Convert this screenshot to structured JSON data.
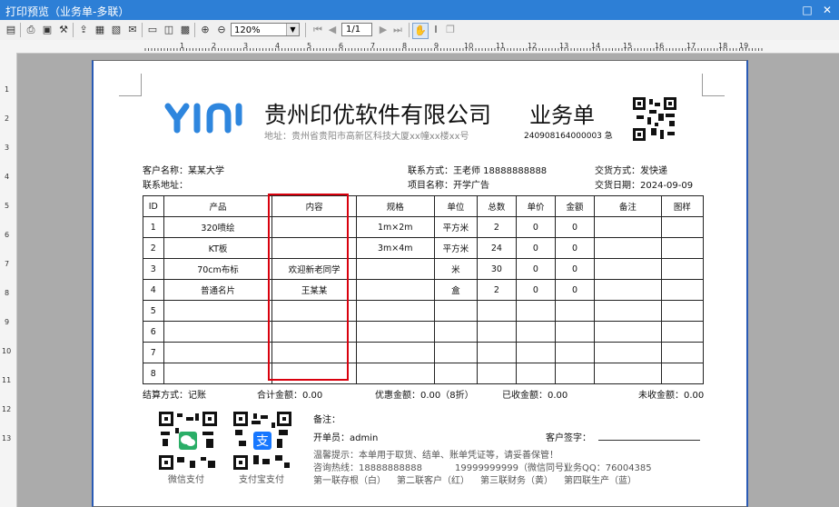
{
  "window": {
    "title": "打印预览（业务单-多联）"
  },
  "toolbar": {
    "zoom": "120%",
    "page": "1/1"
  },
  "ruler": {
    "h_marks": [
      "1",
      "2",
      "3",
      "4",
      "5",
      "6",
      "7",
      "8",
      "9",
      "10",
      "11",
      "12",
      "13",
      "14",
      "15",
      "16",
      "17",
      "18",
      "19"
    ],
    "v_marks": [
      "1",
      "2",
      "3",
      "4",
      "5",
      "6",
      "7",
      "8",
      "9",
      "10",
      "11",
      "12",
      "13"
    ]
  },
  "doc": {
    "company": "贵州印优软件有限公司",
    "address": "地址：贵州省贵阳市高新区科技大厦xx幢xx楼xx号",
    "doc_title": "业务单",
    "doc_no": "240908164000003 急",
    "customer": "客户名称：某某大学",
    "customer_addr": "联系地址：",
    "contact": "联系方式：王老师 18888888888",
    "project": "项目名称：开学广告",
    "delivery_method": "交货方式：发快递",
    "delivery_date": "交货日期：2024-09-09",
    "headers": [
      "ID",
      "产品",
      "内容",
      "规格",
      "单位",
      "总数",
      "单价",
      "金额",
      "备注",
      "图样"
    ],
    "rows": [
      [
        "1",
        "320喷绘",
        "",
        "1m×2m",
        "平方米",
        "2",
        "0",
        "0",
        "",
        ""
      ],
      [
        "2",
        "KT板",
        "",
        "3m×4m",
        "平方米",
        "24",
        "0",
        "0",
        "",
        ""
      ],
      [
        "3",
        "70cm布标",
        "欢迎新老同学",
        "",
        "米",
        "30",
        "0",
        "0",
        "",
        ""
      ],
      [
        "4",
        "普通名片",
        "王某某",
        "",
        "盒",
        "2",
        "0",
        "0",
        "",
        ""
      ],
      [
        "5",
        "",
        "",
        "",
        "",
        "",
        "",
        "",
        "",
        ""
      ],
      [
        "6",
        "",
        "",
        "",
        "",
        "",
        "",
        "",
        "",
        ""
      ],
      [
        "7",
        "",
        "",
        "",
        "",
        "",
        "",
        "",
        "",
        ""
      ],
      [
        "8",
        "",
        "",
        "",
        "",
        "",
        "",
        "",
        "",
        ""
      ]
    ],
    "settle": "结算方式：记账",
    "total": "合计金额：0.00",
    "discount": "优惠金额：0.00（8折）",
    "received": "已收金额：0.00",
    "unreceived": "未收金额：0.00",
    "note": "备注：",
    "operator": "开单员：admin",
    "sign": "客户签字：",
    "hint1": "温馨提示：本单用于取货、结单、账单凭证等，请妥善保管！",
    "hotline": "咨询热线：18888888888",
    "wechat": "19999999999（微信同号）",
    "qq": "业务QQ：76004385",
    "copies": [
      "第一联存根（白）",
      "第二联客户（红）",
      "第三联财务（黄）",
      "第四联生产（蓝）"
    ],
    "wechat_pay": "微信支付",
    "alipay": "支付宝支付"
  },
  "colors": {
    "titlebar": "#2d7fd6",
    "logo": "#2e86de",
    "highlight": "#d9000d"
  }
}
